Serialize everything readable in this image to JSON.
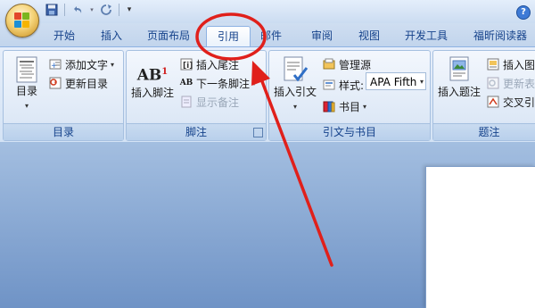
{
  "qat": {
    "icons": [
      "save-icon",
      "undo-icon",
      "redo-icon",
      "customize-icon"
    ]
  },
  "tabs": [
    {
      "label": "开始"
    },
    {
      "label": "插入"
    },
    {
      "label": "页面布局"
    },
    {
      "label": "引用",
      "active": true
    },
    {
      "label": "邮件"
    },
    {
      "label": "审阅"
    },
    {
      "label": "视图"
    },
    {
      "label": "开发工具"
    },
    {
      "label": "福昕阅读器"
    }
  ],
  "groups": {
    "toc": {
      "label": "目录",
      "toc_button": "目录",
      "add_text": "添加文字",
      "update_toc": "更新目录"
    },
    "footnotes": {
      "label": "脚注",
      "insert_footnote": "插入脚注",
      "insert_endnote": "插入尾注",
      "next_footnote": "下一条脚注",
      "show_notes": "显示备注",
      "ab_icon_text": "AB",
      "ab_superscript": "1",
      "ab_small_text": "AB"
    },
    "citations": {
      "label": "引文与书目",
      "insert_citation": "插入引文",
      "manage_sources": "管理源",
      "style_label": "样式:",
      "style_value": "APA Fifth",
      "bibliography": "书目"
    },
    "captions": {
      "label": "题注",
      "insert_caption": "插入题注",
      "insert_table_figures": "插入图",
      "update_table": "更新表",
      "cross_reference": "交叉引"
    }
  },
  "colors": {
    "annotation": "#e0201b",
    "tab_text": "#15428b"
  }
}
